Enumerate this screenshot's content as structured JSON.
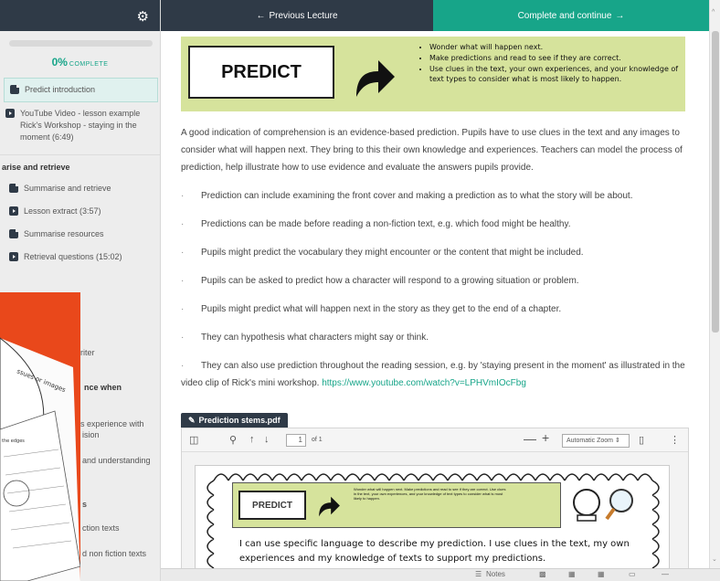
{
  "sidebar": {
    "progress_percent": "0%",
    "progress_fraction": 0,
    "progress_suffix": "COMPLETE",
    "items_top": [
      {
        "label": "Predict introduction",
        "icon": "document-icon",
        "active": true
      },
      {
        "label": "YouTube Video - lesson example Rick's Workshop - staying in the moment (6:49)",
        "icon": "video-icon"
      }
    ],
    "section_summarise": "arise and retrieve",
    "items_summarise": [
      {
        "label": "Summarise and retrieve",
        "icon": "document-icon"
      },
      {
        "label": "Lesson extract (3:57)",
        "icon": "video-icon"
      },
      {
        "label": "Summarise resources",
        "icon": "document-icon"
      },
      {
        "label": "Retrieval questions (15:02)",
        "icon": "video-icon"
      }
    ],
    "partial_writer": "riter",
    "partial_section": "nce when",
    "partial_experience": "s experience with",
    "partial_ension": "ision",
    "partial_understanding": "and understanding",
    "partial_s": "s",
    "partial_fiction": "ction texts",
    "partial_nonfiction": "d non fiction texts"
  },
  "nav": {
    "previous": "Previous Lecture",
    "next": "Complete and continue"
  },
  "banner": {
    "title": "PREDICT",
    "bullets": [
      "Wonder what will happen next.",
      "Make predictions and read to see if they are correct.",
      "Use clues in the text, your own experiences, and your knowledge of text types to consider what is most likely to happen."
    ],
    "colors": {
      "banner": "#d6e39c",
      "accent": "#17a589",
      "dark": "#2f3a47",
      "overlay": "#e9481b"
    }
  },
  "content": {
    "intro": "A good indication of comprehension is an evidence-based prediction. Pupils have to use clues in the text and any images to consider what will happen next. They bring to this their own knowledge and experiences. Teachers can model the process of prediction, help illustrate how to use evidence and evaluate the answers pupils provide.",
    "bullets": [
      "Prediction can include examining the front cover and making a prediction as to what the story will be about.",
      "Predictions can be made before reading a non-fiction text, e.g. which food might be healthy.",
      "Pupils might predict the vocabulary they might encounter or the content that might be included.",
      "Pupils can be asked to predict how a character will respond to a growing situation or problem.",
      "Pupils might predict what will happen next in the story as they get to the end of a chapter.",
      "They can hypothesis what characters might say or think."
    ],
    "last_bullet": "They can also use prediction throughout the reading session, e.g. by 'staying present in the moment' as illustrated in the video clip of Rick's mini workshop.",
    "link": "https://www.youtube.com/watch?v=LPHVmIOcFbg"
  },
  "pdf": {
    "filename": "Prediction stems.pdf",
    "page_number": "1",
    "page_count": "of 1",
    "zoom": "Automatic Zoom",
    "mini_title": "PREDICT",
    "mini_bullets": "Wonder what will happen next. Make predictions and read to see if they are correct. Use clues in the text, your own experiences, and your knowledge of text types to consider what is most likely to happen.",
    "sentence": "I can use specific language to describe my prediction. I use clues in the text, my own experiences and my knowledge of texts to support my predictions."
  },
  "bottombar": {
    "notes": "Notes"
  },
  "overlay": {
    "note1": "ssues or images",
    "note2": "the edges"
  }
}
